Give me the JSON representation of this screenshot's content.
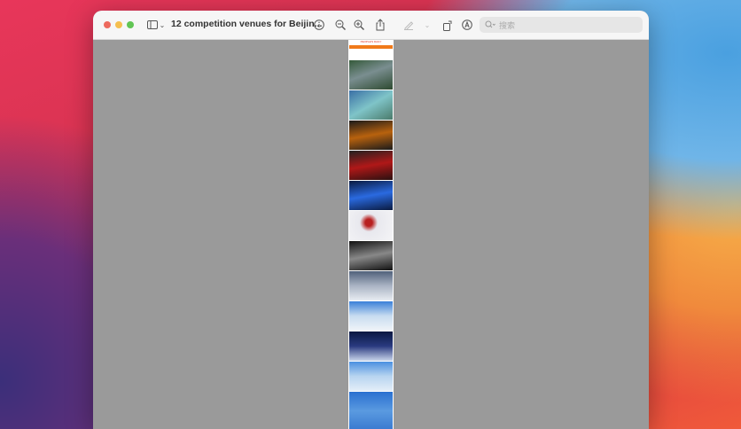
{
  "window": {
    "title": "12 competition venues for Beijin...",
    "search_placeholder": "搜索",
    "traffic_lights": {
      "close": "#ed6a5e",
      "minimize": "#f5bf4f",
      "zoom": "#61c554"
    }
  },
  "toolbar": {
    "icons": [
      "sidebar-icon",
      "chevron-down-icon",
      "info-icon",
      "zoom-out-icon",
      "zoom-in-icon",
      "share-icon",
      "markup-pen-icon",
      "chevron-down-icon",
      "rotate-icon",
      "annotate-icon",
      "search-icon"
    ]
  },
  "document": {
    "header_text": "PEOPLE'S DAILY",
    "accent": "#f07a1a"
  }
}
